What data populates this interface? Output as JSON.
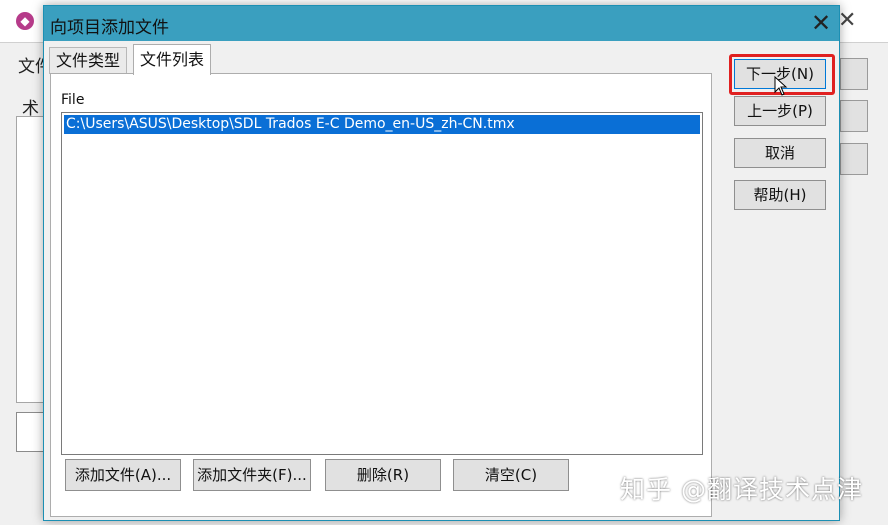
{
  "background_window": {
    "app_icon": "app-logo-icon",
    "close_glyph": "✕",
    "label_fragment_1": "文件",
    "label_fragment_2": "术"
  },
  "dialog": {
    "title": "向项目添加文件",
    "close_glyph": "✕",
    "tabs": [
      {
        "label": "文件类型",
        "active": false
      },
      {
        "label": "文件列表",
        "active": true
      }
    ],
    "file_list": {
      "header": "File",
      "items": [
        "C:\\Users\\ASUS\\Desktop\\SDL Trados E-C Demo_en-US_zh-CN.tmx"
      ]
    },
    "bottom_buttons": {
      "add_file": "添加文件(A)...",
      "add_folder": "添加文件夹(F)...",
      "delete": "删除(R)",
      "clear": "清空(C)"
    },
    "side_buttons": {
      "next": "下一步(N)",
      "back": "上一步(P)",
      "cancel": "取消",
      "help": "帮助(H)"
    }
  },
  "watermark": "知乎 @翻译技术点津",
  "colors": {
    "titlebar": "#3a9fbf",
    "selection": "#0a6fd6",
    "highlight_box": "#e02020"
  }
}
